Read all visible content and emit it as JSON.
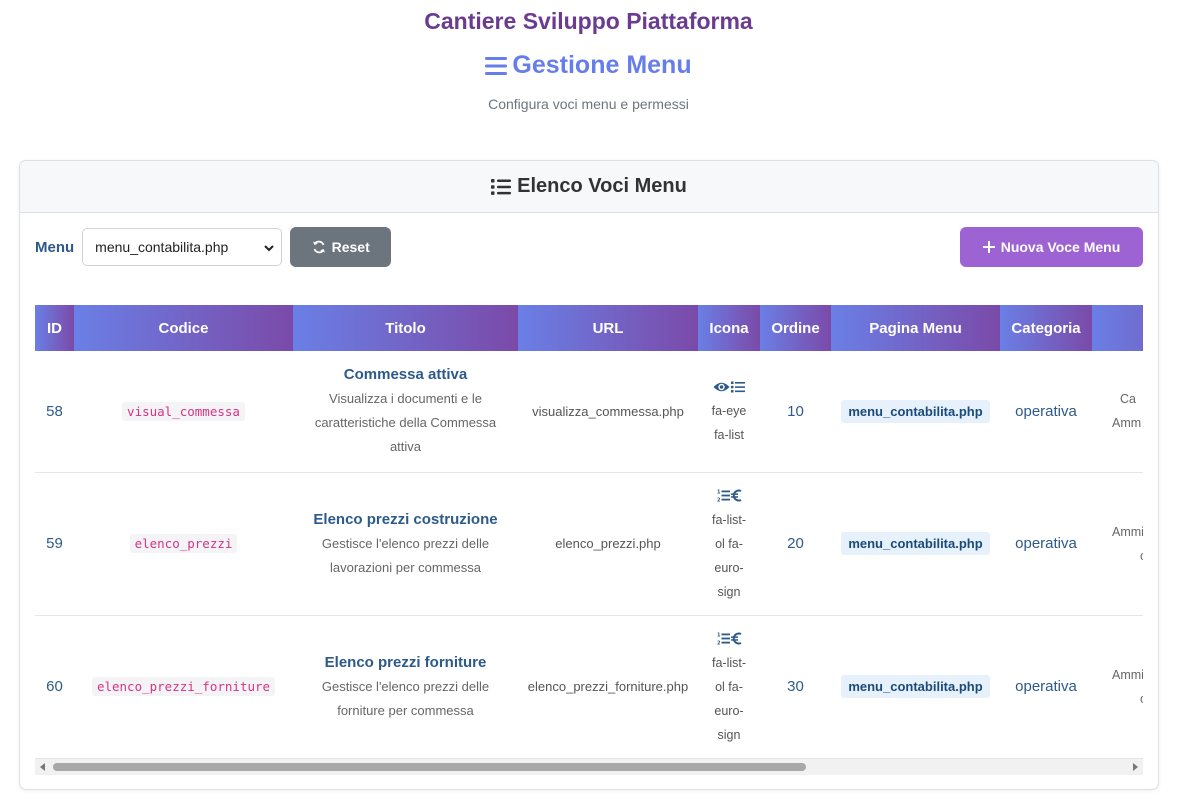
{
  "header": {
    "site_title": "Cantiere Sviluppo Piattaforma",
    "page_title": "Gestione Menu",
    "subtitle": "Configura voci menu e permessi"
  },
  "card": {
    "title": "Elenco Voci Menu"
  },
  "toolbar": {
    "menu_label": "Menu",
    "menu_selected": "menu_contabilita.php",
    "reset_label": "Reset",
    "new_label": "Nuova Voce Menu"
  },
  "table": {
    "headers": {
      "id": "ID",
      "code": "Codice",
      "title": "Titolo",
      "url": "URL",
      "icon": "Icona",
      "order": "Ordine",
      "page": "Pagina Menu",
      "category": "Categoria"
    },
    "rows": [
      {
        "id": "58",
        "code": "visual_commessa",
        "title": "Commessa attiva",
        "desc_lines": [
          "Visualizza i documenti e le",
          "caratteristiche della Commessa",
          "attiva"
        ],
        "url": "visualizza_commessa.php",
        "icon_names": [
          "eye-icon",
          "list-icon"
        ],
        "icon_lines": [
          "fa-eye",
          "fa-list"
        ],
        "order": "10",
        "page": "menu_contabilita.php",
        "category": "operativa",
        "perm_lines": [
          "Ca",
          "Amm"
        ]
      },
      {
        "id": "59",
        "code": "elenco_prezzi",
        "title": "Elenco prezzi costruzione",
        "desc_lines": [
          "Gestisce l'elenco prezzi delle",
          "lavorazioni per commessa"
        ],
        "url": "elenco_prezzi.php",
        "icon_names": [
          "list-ol-icon",
          "euro-sign-icon"
        ],
        "icon_lines": [
          "fa-list-",
          "ol fa-",
          "euro-",
          "sign"
        ],
        "order": "20",
        "page": "menu_contabilita.php",
        "category": "operativa",
        "perm_lines": [
          "Ammi",
          "o"
        ]
      },
      {
        "id": "60",
        "code": "elenco_prezzi_forniture",
        "title": "Elenco prezzi forniture",
        "desc_lines": [
          "Gestisce l'elenco prezzi delle",
          "forniture per commessa"
        ],
        "url": "elenco_prezzi_forniture.php",
        "icon_names": [
          "list-ol-icon",
          "euro-sign-icon"
        ],
        "icon_lines": [
          "fa-list-",
          "ol fa-",
          "euro-",
          "sign"
        ],
        "order": "30",
        "page": "menu_contabilita.php",
        "category": "operativa",
        "perm_lines": [
          "Ammi",
          "o"
        ]
      }
    ]
  },
  "colors": {
    "accent": "#667eea",
    "purple": "#9d63d3",
    "link": "#2d5a8a",
    "code": "#d63384"
  }
}
